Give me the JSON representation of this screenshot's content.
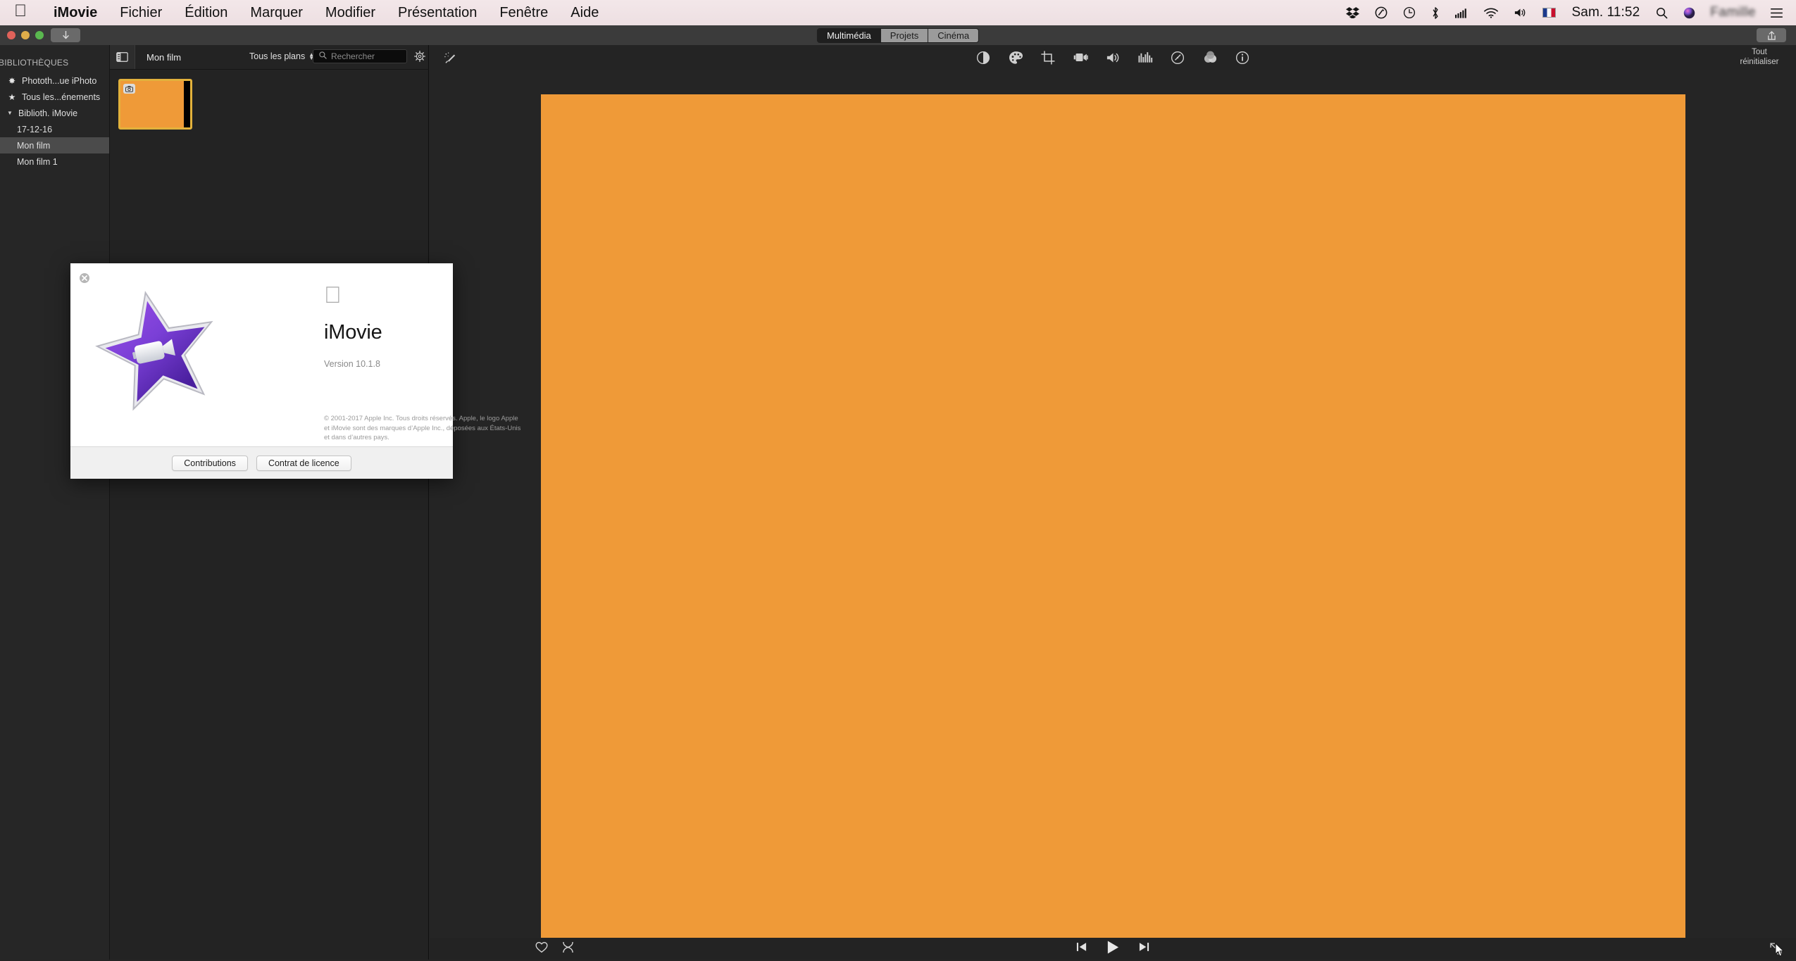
{
  "menubar": {
    "apple_icon": "apple-logo",
    "items": [
      {
        "label": "iMovie",
        "bold": true
      },
      {
        "label": "Fichier",
        "bold": false
      },
      {
        "label": "Édition",
        "bold": false
      },
      {
        "label": "Marquer",
        "bold": false
      },
      {
        "label": "Modifier",
        "bold": false
      },
      {
        "label": "Présentation",
        "bold": false
      },
      {
        "label": "Fenêtre",
        "bold": false
      },
      {
        "label": "Aide",
        "bold": false
      }
    ],
    "tray": [
      {
        "name": "dropbox-icon",
        "glyph": "❖"
      },
      {
        "name": "activity-monitor-icon",
        "glyph": "◎"
      },
      {
        "name": "time-machine-icon",
        "glyph": "◔"
      },
      {
        "name": "bluetooth-icon",
        "glyph": "✻"
      },
      {
        "name": "signal-bars-icon",
        "glyph": "▁▃▅▇"
      },
      {
        "name": "wifi-icon",
        "glyph": "≋"
      },
      {
        "name": "volume-icon",
        "glyph": "🔊"
      }
    ],
    "flag": "french-flag-icon",
    "clock": "Sam. 11:52",
    "search_icon": "spotlight-search-icon",
    "siri_icon": "siri-icon",
    "username": "Famille",
    "list_icon": "notification-center-icon"
  },
  "window": {
    "import_button": "import-media-button",
    "share_button": "share-button",
    "segments": [
      {
        "label": "Multimédia",
        "active": true
      },
      {
        "label": "Projets",
        "active": false
      },
      {
        "label": "Cinéma",
        "active": false
      }
    ]
  },
  "sidebar": {
    "section_header": "BIBLIOTHÈQUES",
    "items": [
      {
        "label": "Phototh...ue iPhoto",
        "icon": "iphoto-icon",
        "glyph": "✸",
        "indent": 0,
        "selected": false,
        "disclosure": ""
      },
      {
        "label": "Tous les...énements",
        "icon": "star-badge-icon",
        "glyph": "★",
        "indent": 0,
        "selected": false,
        "disclosure": ""
      },
      {
        "label": "Biblioth. iMovie",
        "icon": "",
        "glyph": "",
        "indent": 0,
        "selected": false,
        "disclosure": "▼"
      },
      {
        "label": "17-12-16",
        "icon": "",
        "glyph": "",
        "indent": 1,
        "selected": false,
        "disclosure": ""
      },
      {
        "label": "Mon film",
        "icon": "",
        "glyph": "",
        "indent": 1,
        "selected": true,
        "disclosure": ""
      },
      {
        "label": "Mon film 1",
        "icon": "",
        "glyph": "",
        "indent": 1,
        "selected": false,
        "disclosure": ""
      }
    ]
  },
  "browser": {
    "sidebar_toggle": "sidebar-toggle-icon",
    "title": "Mon film",
    "filter_label": "Tous les plans",
    "search_placeholder": "Rechercher",
    "search_value": "",
    "gear_icon": "settings-gear-icon",
    "clip": {
      "badge_icon": "camera-icon",
      "selected": true
    }
  },
  "inspector_toolbar": {
    "wand": "auto-enhance-wand-icon",
    "tools": [
      {
        "name": "color-balance-icon",
        "glyph": "◑"
      },
      {
        "name": "color-correction-icon",
        "glyph": "palette"
      },
      {
        "name": "crop-icon",
        "glyph": "crop"
      },
      {
        "name": "stabilization-icon",
        "glyph": "videocam"
      },
      {
        "name": "volume-icon",
        "glyph": "speaker"
      },
      {
        "name": "audio-equalizer-icon",
        "glyph": "equalizer"
      },
      {
        "name": "speed-icon",
        "glyph": "gauge"
      },
      {
        "name": "filters-icon",
        "glyph": "venn"
      },
      {
        "name": "info-icon",
        "glyph": "info"
      }
    ],
    "reset_all": "Tout réinitialiser"
  },
  "viewer": {
    "background_color": "#ef9a38"
  },
  "bottombar": {
    "favorite_icon": "heart-favorite-icon",
    "reject_icon": "reject-x-icon",
    "transport": [
      {
        "name": "previous-clip-button",
        "glyph": "prev"
      },
      {
        "name": "play-button",
        "glyph": "play"
      },
      {
        "name": "next-clip-button",
        "glyph": "next"
      }
    ],
    "fullscreen_icon": "fullscreen-toggle-icon"
  },
  "about_dialog": {
    "close_icon": "close-dialog-icon",
    "app_icon": "imovie-star-icon",
    "apple_logo": "apple-logo-icon",
    "app_name": "iMovie",
    "version": "Version 10.1.8",
    "copyright": "© 2001-2017 Apple Inc. Tous droits réservés. Apple, le logo Apple et iMovie sont des marques d’Apple Inc., déposées aux États-Unis et dans d’autres pays.",
    "buttons": [
      {
        "label": "Contributions",
        "name": "credits-button"
      },
      {
        "label": "Contrat de licence",
        "name": "license-agreement-button"
      }
    ]
  }
}
